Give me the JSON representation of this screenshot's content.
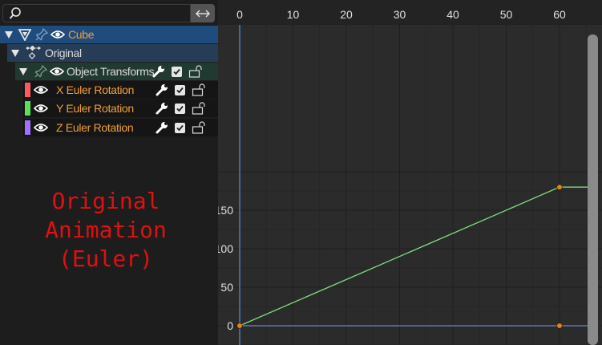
{
  "channels": {
    "search": {
      "placeholder": ""
    },
    "object": {
      "label": "Cube"
    },
    "action": {
      "label": "Original"
    },
    "group": {
      "label": "Object Transforms"
    },
    "curves": [
      {
        "label": "X Euler Rotation",
        "color": "#ff5a5a"
      },
      {
        "label": "Y Euler Rotation",
        "color": "#5ce05c"
      },
      {
        "label": "Z Euler Rotation",
        "color": "#a070ff"
      }
    ]
  },
  "caption": {
    "line1": "Original",
    "line2": "Animation",
    "line3": "(Euler)"
  },
  "chart_data": {
    "type": "line",
    "x_ticks": [
      0,
      10,
      20,
      30,
      40,
      50,
      60
    ],
    "y_ticks": [
      0,
      50,
      100,
      150
    ],
    "series": [
      {
        "name": "Y Euler Rotation",
        "color": "#7fdc7f",
        "x": [
          0,
          60,
          67
        ],
        "y": [
          0,
          180,
          180
        ],
        "keyframes": [
          [
            0,
            0
          ],
          [
            60,
            180
          ]
        ]
      },
      {
        "name": "Z Euler Rotation",
        "color": "#6d7fd6",
        "x": [
          0,
          60,
          67
        ],
        "y": [
          0,
          0,
          0
        ],
        "keyframes": [
          [
            0,
            0
          ],
          [
            60,
            0
          ]
        ]
      }
    ],
    "current_frame": 0
  }
}
